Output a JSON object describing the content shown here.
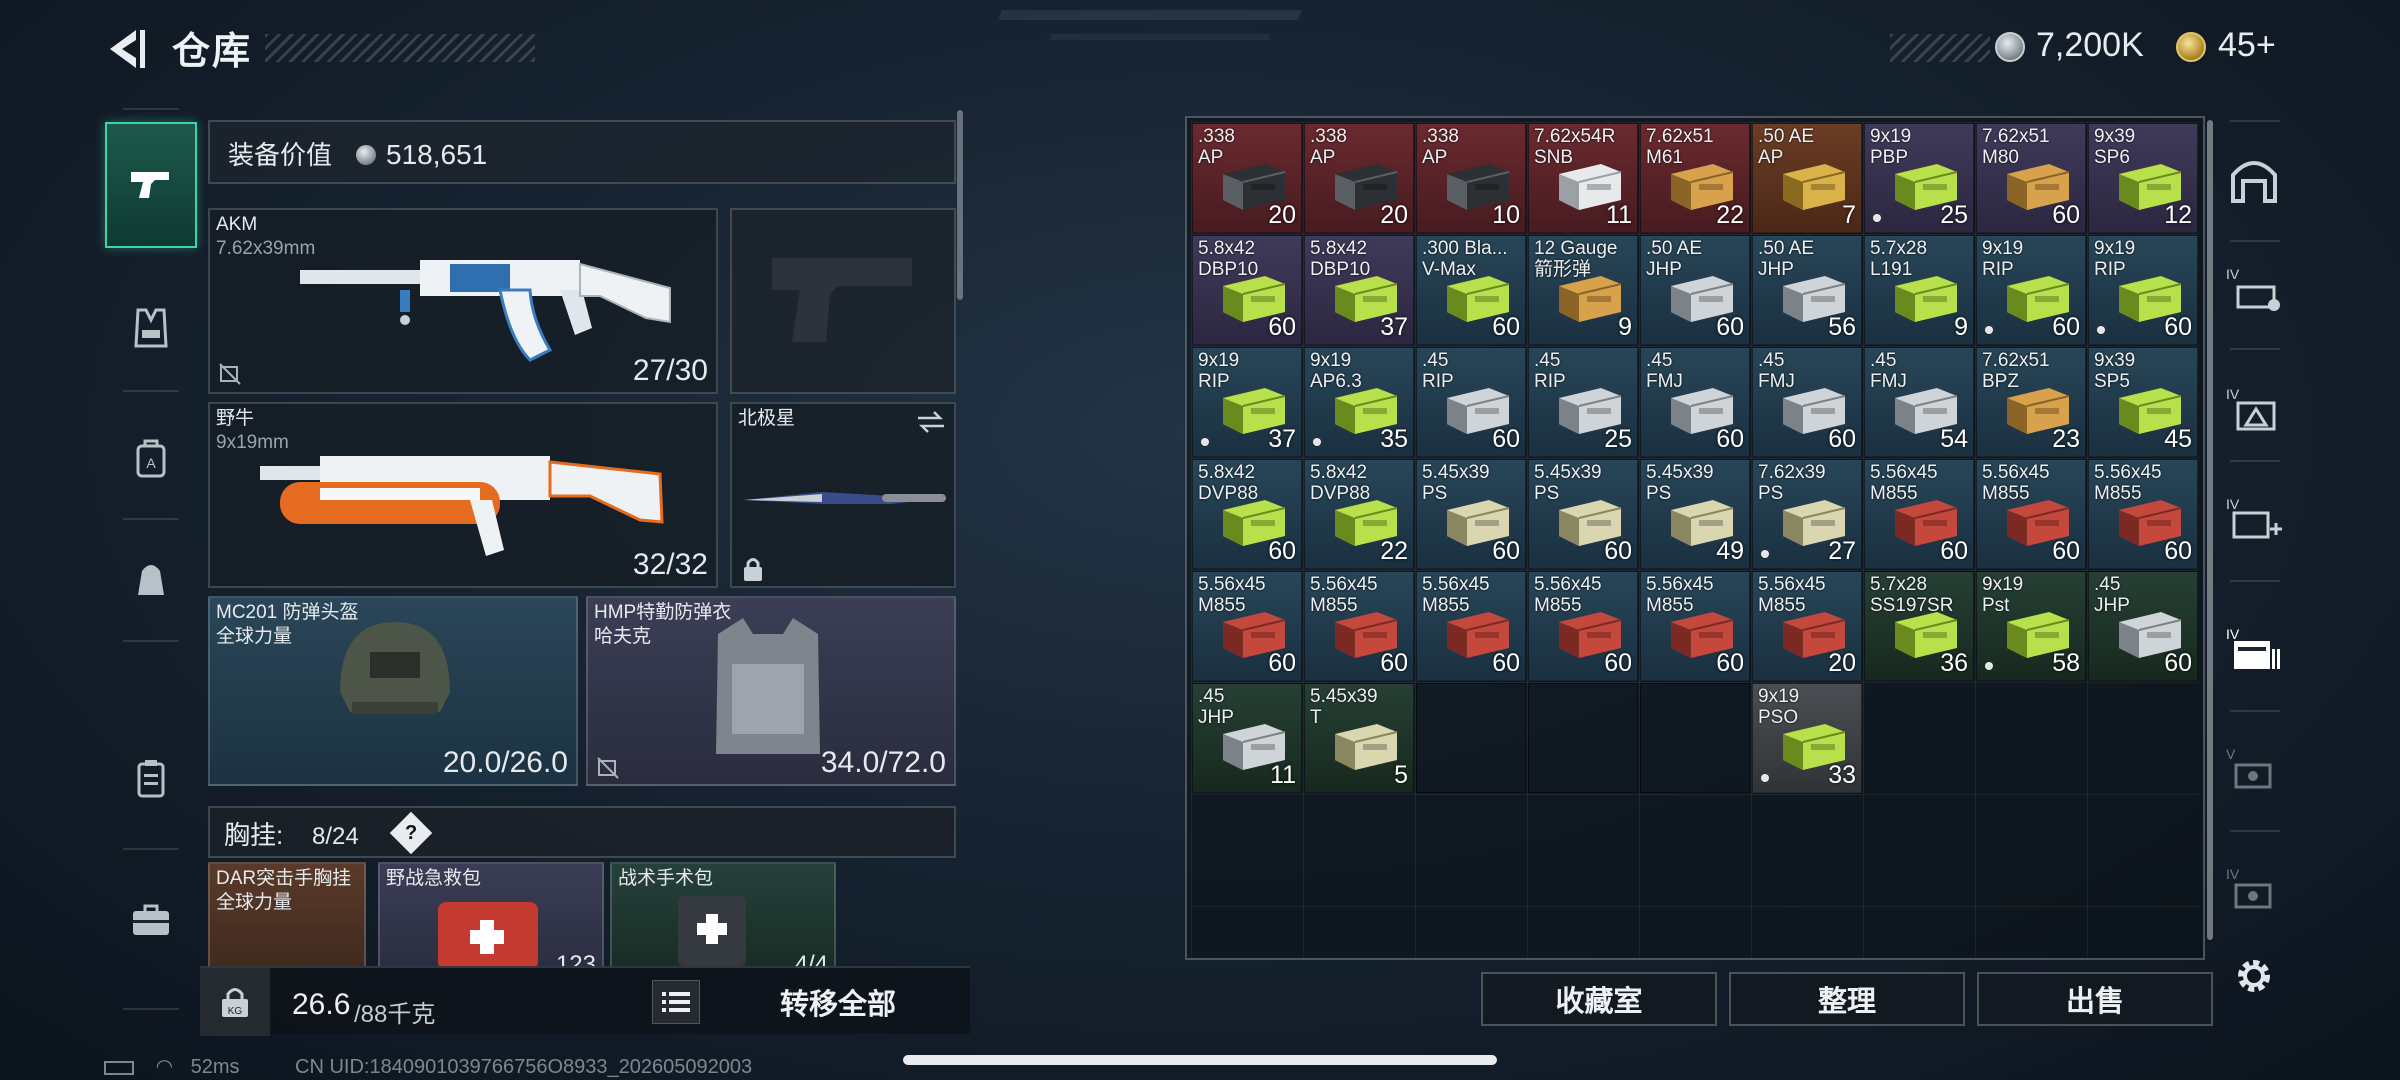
{
  "header": {
    "title": "仓库",
    "coin_value": "7,200K",
    "gold_value": "45+"
  },
  "equipment": {
    "value_label": "装备价值",
    "value": "518,651",
    "primary": {
      "name": "AKM",
      "caliber": "7.62x39mm",
      "ammo": "27/30"
    },
    "secondary": {
      "name": "野牛",
      "caliber": "9x19mm",
      "ammo": "32/32"
    },
    "melee": {
      "name": "北极星"
    },
    "helmet": {
      "name": "MC201 防弹头盔",
      "brand": "全球力量",
      "durability": "20.0/26.0"
    },
    "armor": {
      "name": "HMP特勤防弹衣",
      "brand": "哈夫克",
      "durability": "34.0/72.0"
    },
    "rig": {
      "label": "胸挂:",
      "count": "8/24",
      "help": "?"
    },
    "rig_items": [
      {
        "name": "DAR突击手胸挂",
        "brand": "全球力量"
      },
      {
        "name": "野战急救包",
        "qty": "123"
      },
      {
        "name": "战术手术包",
        "qty": "4/4"
      }
    ],
    "weight": {
      "value": "26.6",
      "max": "/88千克"
    },
    "transfer_all": "转移全部"
  },
  "stash": {
    "cells": [
      {
        "name": ".338\nAP",
        "qty": "20",
        "color": "red",
        "box": "dark"
      },
      {
        "name": ".338\nAP",
        "qty": "20",
        "color": "red",
        "box": "dark"
      },
      {
        "name": ".338\nAP",
        "qty": "10",
        "color": "red",
        "box": "dark"
      },
      {
        "name": "7.62x54R\nSNB",
        "qty": "11",
        "color": "red",
        "box": "white"
      },
      {
        "name": "7.62x51\nM61",
        "qty": "22",
        "color": "red",
        "box": "tan"
      },
      {
        "name": ".50 AE\nAP",
        "qty": "7",
        "color": "orange",
        "box": "brass"
      },
      {
        "name": "9x19\nPBP",
        "qty": "25",
        "color": "purple",
        "box": "lime",
        "dot": true
      },
      {
        "name": "7.62x51\nM80",
        "qty": "60",
        "color": "purple",
        "box": "tan"
      },
      {
        "name": "9x39\nSP6",
        "qty": "12",
        "color": "purple",
        "box": "lime"
      },
      {
        "name": "5.8x42\nDBP10",
        "qty": "60",
        "color": "purple",
        "box": "lime"
      },
      {
        "name": "5.8x42\nDBP10",
        "qty": "37",
        "color": "purple",
        "box": "lime"
      },
      {
        "name": ".300 Bla...\nV-Max",
        "qty": "60",
        "color": "blue",
        "box": "lime"
      },
      {
        "name": "12 Gauge\n箭形弹",
        "qty": "9",
        "color": "blue",
        "box": "tan"
      },
      {
        "name": ".50 AE\nJHP",
        "qty": "60",
        "color": "blue",
        "box": "silver"
      },
      {
        "name": ".50 AE\nJHP",
        "qty": "56",
        "color": "blue",
        "box": "silver"
      },
      {
        "name": "5.7x28\nL191",
        "qty": "9",
        "color": "blue",
        "box": "lime"
      },
      {
        "name": "9x19\nRIP",
        "qty": "60",
        "color": "blue",
        "box": "lime",
        "dot": true
      },
      {
        "name": "9x19\nRIP",
        "qty": "60",
        "color": "blue",
        "box": "lime",
        "dot": true
      },
      {
        "name": "9x19\nRIP",
        "qty": "37",
        "color": "blue",
        "box": "lime",
        "dot": true
      },
      {
        "name": "9x19\nAP6.3",
        "qty": "35",
        "color": "blue",
        "box": "lime",
        "dot": true
      },
      {
        "name": ".45\nRIP",
        "qty": "60",
        "color": "blue",
        "box": "silver"
      },
      {
        "name": ".45\nRIP",
        "qty": "25",
        "color": "blue",
        "box": "silver"
      },
      {
        "name": ".45\nFMJ",
        "qty": "60",
        "color": "blue",
        "box": "silver"
      },
      {
        "name": ".45\nFMJ",
        "qty": "60",
        "color": "blue",
        "box": "silver"
      },
      {
        "name": ".45\nFMJ",
        "qty": "54",
        "color": "blue",
        "box": "silver"
      },
      {
        "name": "7.62x51\nBPZ",
        "qty": "23",
        "color": "blue",
        "box": "tan"
      },
      {
        "name": "9x39\nSP5",
        "qty": "45",
        "color": "blue",
        "box": "lime"
      },
      {
        "name": "5.8x42\nDVP88",
        "qty": "60",
        "color": "blue",
        "box": "lime"
      },
      {
        "name": "5.8x42\nDVP88",
        "qty": "22",
        "color": "blue",
        "box": "lime"
      },
      {
        "name": "5.45x39\nPS",
        "qty": "60",
        "color": "blue",
        "box": "olive"
      },
      {
        "name": "5.45x39\nPS",
        "qty": "60",
        "color": "blue",
        "box": "olive"
      },
      {
        "name": "5.45x39\nPS",
        "qty": "49",
        "color": "blue",
        "box": "olive"
      },
      {
        "name": "7.62x39\nPS",
        "qty": "27",
        "color": "blue",
        "box": "olive",
        "dot": true
      },
      {
        "name": "5.56x45\nM855",
        "qty": "60",
        "color": "blue",
        "box": "redbox"
      },
      {
        "name": "5.56x45\nM855",
        "qty": "60",
        "color": "blue",
        "box": "redbox"
      },
      {
        "name": "5.56x45\nM855",
        "qty": "60",
        "color": "blue",
        "box": "redbox"
      },
      {
        "name": "5.56x45\nM855",
        "qty": "60",
        "color": "blue",
        "box": "redbox"
      },
      {
        "name": "5.56x45\nM855",
        "qty": "60",
        "color": "blue",
        "box": "redbox"
      },
      {
        "name": "5.56x45\nM855",
        "qty": "60",
        "color": "blue",
        "box": "redbox"
      },
      {
        "name": "5.56x45\nM855",
        "qty": "60",
        "color": "blue",
        "box": "redbox"
      },
      {
        "name": "5.56x45\nM855",
        "qty": "60",
        "color": "blue",
        "box": "redbox"
      },
      {
        "name": "5.56x45\nM855",
        "qty": "20",
        "color": "blue",
        "box": "redbox"
      },
      {
        "name": "5.7x28\nSS197SR",
        "qty": "36",
        "color": "green",
        "box": "lime"
      },
      {
        "name": "9x19\nPst",
        "qty": "58",
        "color": "green",
        "box": "lime",
        "dot": true
      },
      {
        "name": ".45\nJHP",
        "qty": "60",
        "color": "green",
        "box": "silver"
      },
      {
        "name": ".45\nJHP",
        "qty": "11",
        "color": "green",
        "box": "silver"
      },
      {
        "name": "5.45x39\nT",
        "qty": "5",
        "color": "green",
        "box": "olive"
      },
      {
        "name": "",
        "qty": "",
        "color": "none"
      },
      {
        "name": "",
        "qty": "",
        "color": "none"
      },
      {
        "name": "",
        "qty": "",
        "color": "none"
      },
      {
        "name": "9x19\nPSO",
        "qty": "33",
        "color": "gray",
        "box": "lime",
        "dot": true
      }
    ]
  },
  "bottom_buttons": {
    "collection": "收藏室",
    "organize": "整理",
    "sell": "出售"
  },
  "status": {
    "ping": "52ms",
    "uid": "CN UID:1840901039766756O8933_202605092003"
  }
}
